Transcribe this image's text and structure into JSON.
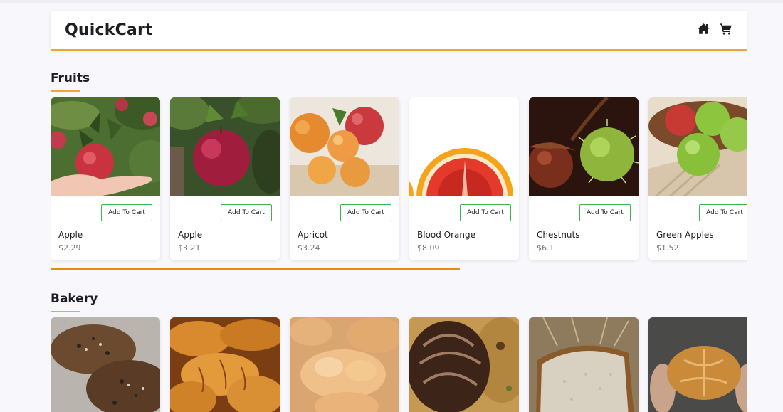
{
  "header": {
    "title": "QuickCart",
    "icons": [
      "home-icon",
      "cart-icon"
    ]
  },
  "sections": [
    {
      "title": "Fruits",
      "products": [
        {
          "name": "Apple",
          "price": "$2.29",
          "button": "Add To Cart"
        },
        {
          "name": "Apple",
          "price": "$3.21",
          "button": "Add To Cart"
        },
        {
          "name": "Apricot",
          "price": "$3.24",
          "button": "Add To Cart"
        },
        {
          "name": "Blood Orange",
          "price": "$8.09",
          "button": "Add To Cart"
        },
        {
          "name": "Chestnuts",
          "price": "$6.1",
          "button": "Add To Cart"
        },
        {
          "name": "Green Apples",
          "price": "$1.52",
          "button": "Add To Cart"
        }
      ]
    },
    {
      "title": "Bakery",
      "products": []
    }
  ],
  "colors": {
    "accent": "#f0a43a",
    "scrollbar": "#ea8a0b",
    "button_border": "#3cb44b",
    "background": "#f8f7fb"
  }
}
